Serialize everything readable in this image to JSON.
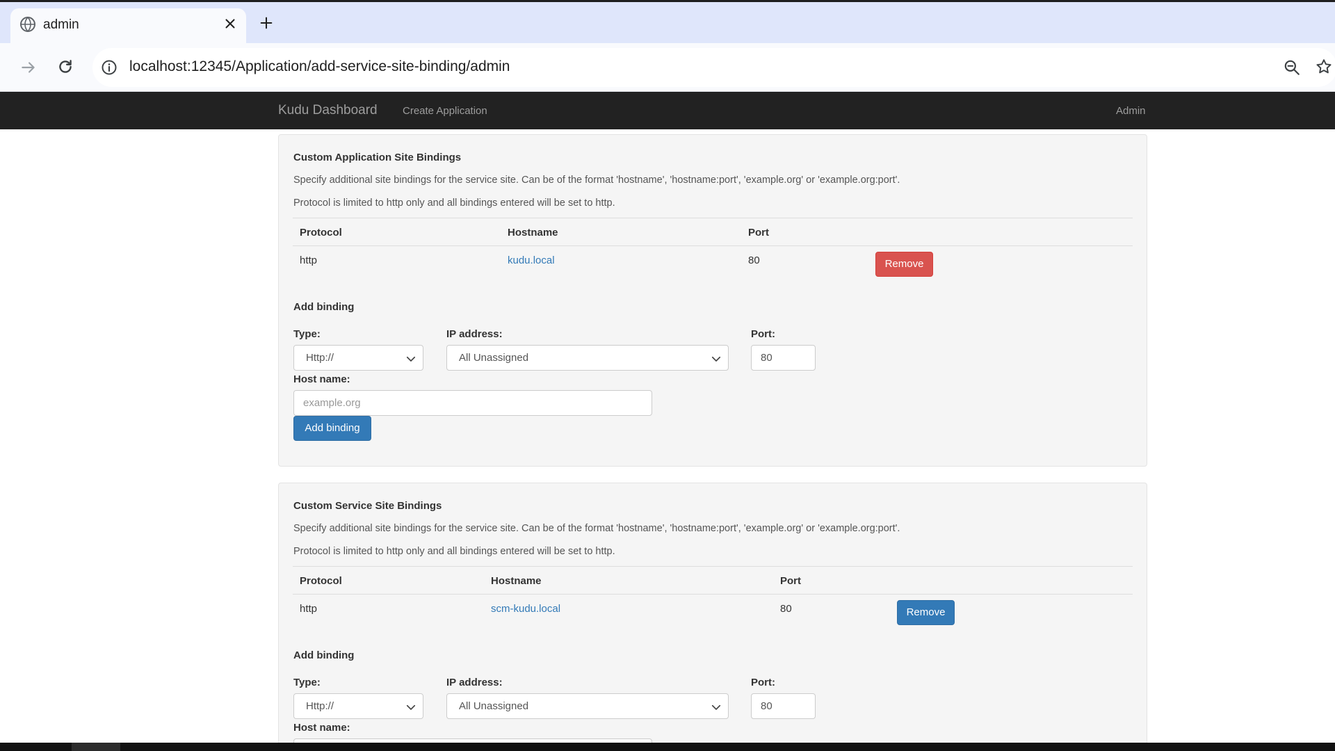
{
  "browser": {
    "tab_title": "admin",
    "url": "localhost:12345/Application/add-service-site-binding/admin",
    "icons": {
      "tab": "globe-icon",
      "close": "close-icon",
      "new_tab": "plus-icon",
      "forward": "arrow-forward-icon",
      "reload": "reload-icon",
      "site_info": "info-icon",
      "zoom": "zoom-icon",
      "bookmark": "star-icon"
    }
  },
  "navbar": {
    "brand": "Kudu Dashboard",
    "create_application": "Create Application",
    "admin": "Admin"
  },
  "app_bindings": {
    "title": "Custom Application Site Bindings",
    "desc1": "Specify additional site bindings for the service site. Can be of the format 'hostname', 'hostname:port', 'example.org' or 'example.org:port'.",
    "desc2": "Protocol is limited to http only and all bindings entered will be set to http.",
    "columns": {
      "protocol": "Protocol",
      "hostname": "Hostname",
      "port": "Port"
    },
    "rows": [
      {
        "protocol": "http",
        "hostname": "kudu.local",
        "port": "80",
        "action": "Remove"
      }
    ],
    "add": {
      "heading": "Add binding",
      "type_label": "Type:",
      "type_value": "Http://",
      "ip_label": "IP address:",
      "ip_value": "All Unassigned",
      "port_label": "Port:",
      "port_value": "80",
      "host_label": "Host name:",
      "host_placeholder": "example.org",
      "button": "Add binding"
    }
  },
  "svc_bindings": {
    "title": "Custom Service Site Bindings",
    "desc1": "Specify additional site bindings for the service site. Can be of the format 'hostname', 'hostname:port', 'example.org' or 'example.org:port'.",
    "desc2": "Protocol is limited to http only and all bindings entered will be set to http.",
    "columns": {
      "protocol": "Protocol",
      "hostname": "Hostname",
      "port": "Port"
    },
    "rows": [
      {
        "protocol": "http",
        "hostname": "scm-kudu.local",
        "port": "80",
        "action": "Remove"
      }
    ],
    "add": {
      "heading": "Add binding",
      "type_label": "Type:",
      "type_value": "Http://",
      "ip_label": "IP address:",
      "ip_value": "All Unassigned",
      "port_label": "Port:",
      "port_value": "80",
      "host_label": "Host name:"
    }
  },
  "colors": {
    "navbar_bg": "#222222",
    "navbar_text": "#9d9d9d",
    "link": "#337ab7",
    "danger": "#d9534f",
    "primary": "#337ab7",
    "panel_bg": "#f5f5f5"
  }
}
